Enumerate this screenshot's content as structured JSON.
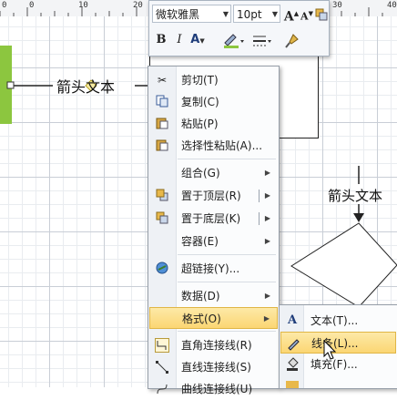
{
  "ruler": {
    "numbers": [
      "0",
      "0",
      "10",
      "20",
      "30",
      "40"
    ]
  },
  "canvas": {
    "left_arrow_label": "箭头文本",
    "right_arrow_label": "箭头文本",
    "colors": {
      "green_shape": "#8cc63f",
      "grid": "#c9ced6"
    }
  },
  "mini_toolbar": {
    "font_name": "微软雅黑",
    "font_size": "10pt",
    "buttons": [
      "grow-font",
      "shrink-font",
      "bring-forward",
      "send-backward",
      "bold",
      "italic",
      "font-color",
      "line-color",
      "line-style",
      "format-painter"
    ],
    "bold_label": "B",
    "italic_label": "I",
    "font_color_label": "A",
    "grow_label": "A",
    "shrink_label": "A"
  },
  "context_menu": {
    "items": [
      {
        "label": "剪切(T)",
        "icon": "scissors-icon"
      },
      {
        "label": "复制(C)",
        "icon": "copy-icon"
      },
      {
        "label": "粘贴(P)",
        "icon": "paste-icon"
      },
      {
        "label": "选择性粘贴(A)...",
        "icon": "paste-special-icon"
      },
      {
        "label": "组合(G)",
        "submenu": true
      },
      {
        "label": "置于顶层(R)",
        "icon": "bring-to-front-icon",
        "submenu": true
      },
      {
        "label": "置于底层(K)",
        "icon": "send-to-back-icon",
        "submenu": true
      },
      {
        "label": "容器(E)",
        "submenu": true
      },
      {
        "label": "超链接(Y)...",
        "icon": "hyperlink-icon"
      },
      {
        "label": "数据(D)",
        "submenu": true
      },
      {
        "label": "格式(O)",
        "submenu": true,
        "highlighted": true
      },
      {
        "label": "直角连接线(R)",
        "icon": "right-angle-connector-icon"
      },
      {
        "label": "直线连接线(S)",
        "icon": "straight-connector-icon"
      },
      {
        "label": "曲线连接线(U)",
        "icon": "curved-connector-icon"
      }
    ]
  },
  "format_submenu": {
    "items": [
      {
        "label": "文本(T)...",
        "icon": "text-icon"
      },
      {
        "label": "线条(L)...",
        "icon": "line-icon",
        "highlighted": true
      },
      {
        "label": "填充(F)...",
        "icon": "fill-icon"
      }
    ]
  }
}
